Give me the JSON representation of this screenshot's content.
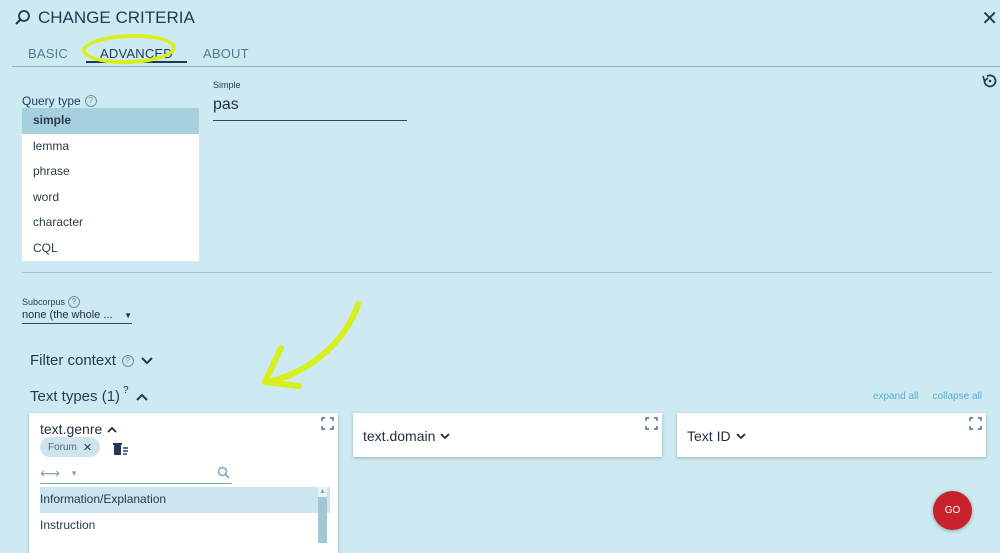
{
  "dialog": {
    "title": "CHANGE CRITERIA",
    "close_symbol": "✕"
  },
  "tabs": [
    {
      "label": "BASIC",
      "active": false
    },
    {
      "label": "ADVANCED",
      "active": true
    },
    {
      "label": "ABOUT",
      "active": false
    }
  ],
  "query_type": {
    "label": "Query type",
    "options": [
      "simple",
      "lemma",
      "phrase",
      "word",
      "character",
      "CQL"
    ],
    "selected": "simple"
  },
  "simple_query": {
    "label": "Simple",
    "value": "pas"
  },
  "subcorpus": {
    "label": "Subcorpus",
    "value": "none (the whole ..."
  },
  "filter_context": {
    "label": "Filter context"
  },
  "text_types": {
    "label": "Text types (1)",
    "superscript": "?",
    "expand_all": "expand all",
    "collapse_all": "collapse all"
  },
  "cards": {
    "genre": {
      "title": "text.genre",
      "chip": "Forum",
      "values": [
        "Information/Explanation",
        "Instruction"
      ],
      "selected_value": "Information/Explanation"
    },
    "domain": {
      "title": "text.domain"
    },
    "textid": {
      "title": "Text ID"
    }
  },
  "go_button": {
    "label": "GO"
  },
  "colors": {
    "background": "#cdeaf2",
    "accent": "#1e3a56",
    "highlight_annotation": "#d9ef1d",
    "go": "#c8232c"
  }
}
